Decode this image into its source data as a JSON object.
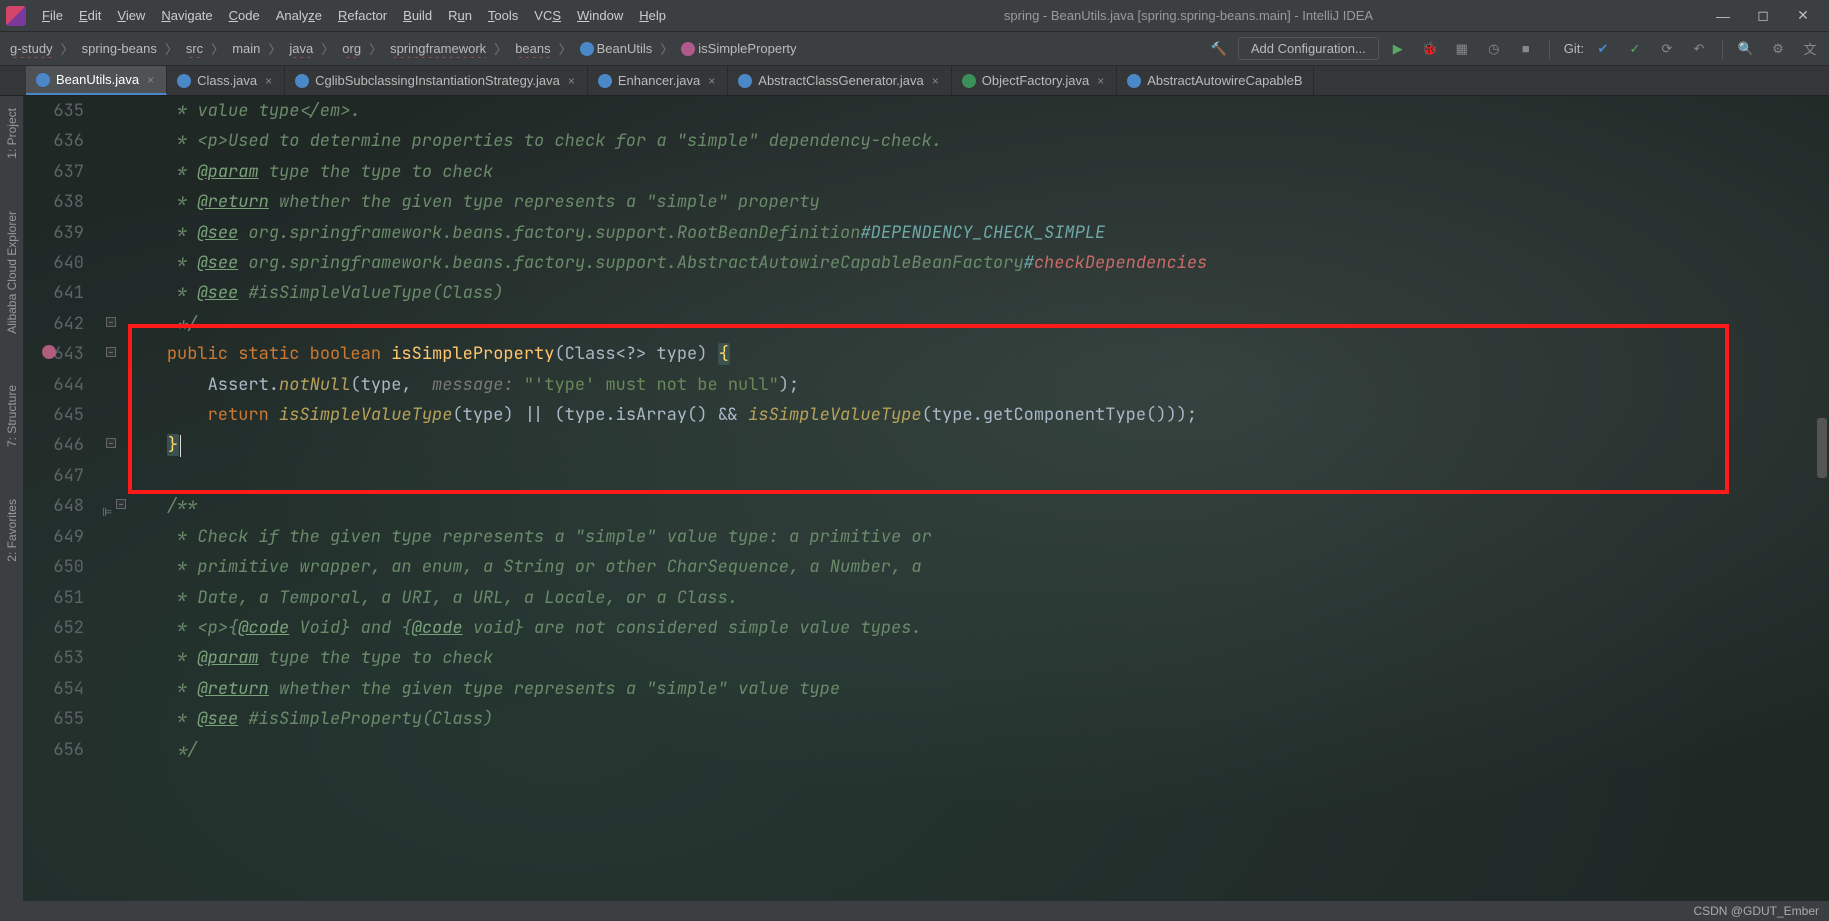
{
  "window": {
    "title": "spring - BeanUtils.java [spring.spring-beans.main] - IntelliJ IDEA"
  },
  "menu": {
    "file": "File",
    "edit": "Edit",
    "view": "View",
    "navigate": "Navigate",
    "code": "Code",
    "analyze": "Analyze",
    "refactor": "Refactor",
    "build": "Build",
    "run": "Run",
    "tools": "Tools",
    "vcs": "VCS",
    "window": "Window",
    "help": "Help"
  },
  "breadcrumbs": {
    "items": [
      {
        "label": "g-study",
        "wavy": true
      },
      {
        "label": "spring-beans"
      },
      {
        "label": "src",
        "wavy": true
      },
      {
        "label": "main"
      },
      {
        "label": "java",
        "wavy": true
      },
      {
        "label": "org",
        "wavy": true
      },
      {
        "label": "springframework",
        "wavy": true
      },
      {
        "label": "beans",
        "wavy": true
      },
      {
        "label": "BeanUtils",
        "icon": "c"
      },
      {
        "label": "isSimpleProperty",
        "icon": "m"
      }
    ]
  },
  "toolbar": {
    "addconf": "Add Configuration...",
    "git": "Git:"
  },
  "tabs": [
    {
      "label": "BeanUtils.java",
      "icon": "class",
      "active": true
    },
    {
      "label": "Class.java",
      "icon": "class"
    },
    {
      "label": "CglibSubclassingInstantiationStrategy.java",
      "icon": "class"
    },
    {
      "label": "Enhancer.java",
      "icon": "class"
    },
    {
      "label": "AbstractClassGenerator.java",
      "icon": "class"
    },
    {
      "label": "ObjectFactory.java",
      "icon": "iface"
    },
    {
      "label": "AbstractAutowireCapableB",
      "icon": "class",
      "noclose": true
    }
  ],
  "sidebar": {
    "project": "1: Project",
    "cloud": "Alibaba Cloud Explorer",
    "structure": "7: Structure",
    "favorites": "2: Favorites"
  },
  "code": {
    "l635": " * value type</em>.",
    "l636": " * <p>Used to determine properties to check for a \"simple\" dependency-check.",
    "l637_a": " * ",
    "l637_tag": "@param",
    "l637_b": " type the type to check",
    "l638_a": " * ",
    "l638_tag": "@return",
    "l638_b": " whether the given type represents a \"simple\" property",
    "l639_a": " * ",
    "l639_tag": "@see",
    "l639_b": " org.springframework.beans.factory.support.RootBeanDefinition",
    "l639_c": "#DEPENDENCY_CHECK_SIMPLE",
    "l640_a": " * ",
    "l640_tag": "@see",
    "l640_b": " org.springframework.beans.factory.support.AbstractAutowireCapableBeanFactory",
    "l640_c": "#",
    "l640_d": "checkDependencies",
    "l641_a": " * ",
    "l641_tag": "@see",
    "l641_b": " #isSimpleValueType(Class)",
    "l642": " */",
    "l643_kw1": "public",
    "l643_kw2": "static",
    "l643_kw3": "boolean",
    "l643_m": "isSimpleProperty",
    "l643_sig": "(Class<?> type) ",
    "l643_brace": "{",
    "l644_a": "Assert.",
    "l644_b": "notNull",
    "l644_c": "(type,  ",
    "l644_hint": "message:",
    "l644_str": " \"'type' must not be null\"",
    "l644_d": ");",
    "l645_kw": "return",
    "l645_a": " ",
    "l645_m1": "isSimpleValueType",
    "l645_b": "(type) || (type.isArray() && ",
    "l645_m2": "isSimpleValueType",
    "l645_c": "(type.getComponentType()));",
    "l646_brace": "}",
    "l648": "/**",
    "l649": " * Check if the given type represents a \"simple\" value type: a primitive or",
    "l650": " * primitive wrapper, an enum, a String or other CharSequence, a Number, a",
    "l651": " * Date, a Temporal, a URI, a URL, a Locale, or a Class.",
    "l652_a": " * <p>{",
    "l652_tag1": "@code",
    "l652_b": " Void} and {",
    "l652_tag2": "@code",
    "l652_c": " void} are not considered simple value types.",
    "l653_a": " * ",
    "l653_tag": "@param",
    "l653_b": " type the type to check",
    "l654_a": " * ",
    "l654_tag": "@return",
    "l654_b": " whether the given type represents a \"simple\" value type",
    "l655_a": " * ",
    "l655_tag": "@see",
    "l655_b": " #isSimpleProperty(Class)",
    "l656": " */"
  },
  "linenums": {
    "n635": "635",
    "n636": "636",
    "n637": "637",
    "n638": "638",
    "n639": "639",
    "n640": "640",
    "n641": "641",
    "n642": "642",
    "n643": "643",
    "n644": "644",
    "n645": "645",
    "n646": "646",
    "n647": "647",
    "n648": "648",
    "n649": "649",
    "n650": "650",
    "n651": "651",
    "n652": "652",
    "n653": "653",
    "n654": "654",
    "n655": "655",
    "n656": "656"
  },
  "status": {
    "watermark": "CSDN @GDUT_Ember"
  }
}
